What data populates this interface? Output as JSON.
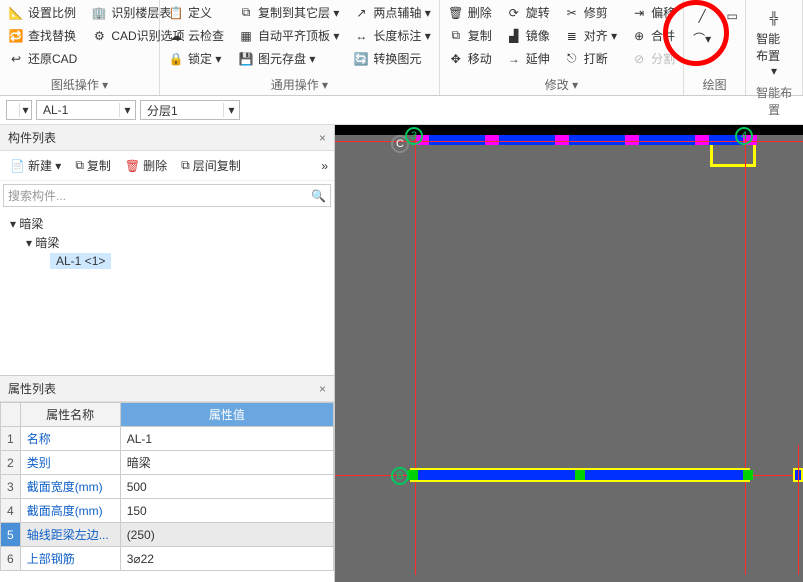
{
  "ribbon": {
    "left": {
      "items": [
        "设置比例",
        "查找替换",
        "还原CAD",
        "识别楼层表",
        "CAD识别选项"
      ],
      "label": "图纸操作 ▾"
    },
    "group2": {
      "col1": [
        "定义",
        "云检查",
        "锁定 ▾"
      ],
      "col2": [
        "复制到其它层 ▾",
        "自动平齐顶板 ▾",
        "图元存盘 ▾"
      ],
      "col3": [
        "两点辅轴 ▾",
        "长度标注 ▾",
        "转换图元"
      ],
      "label": "通用操作 ▾"
    },
    "group3": {
      "col1": [
        "删除",
        "复制",
        "移动"
      ],
      "col2": [
        "旋转",
        "镜像",
        "延伸"
      ],
      "col3": [
        "修剪",
        "对齐 ▾",
        "打断"
      ],
      "col4": [
        "偏移",
        "合并",
        "分割"
      ],
      "label": "修改 ▾"
    },
    "group4": {
      "label": "绘图"
    },
    "group5": {
      "big": "智能布置",
      "label": "智能布置"
    }
  },
  "selectors": {
    "left": "▾",
    "al": "AL-1",
    "layer": "分层1"
  },
  "componentList": {
    "title": "构件列表",
    "buttons": {
      "new": "新建 ▾",
      "copy": "复制",
      "del": "删除",
      "layercopy": "层间复制"
    },
    "searchPlaceholder": "搜索构件...",
    "tree": {
      "root": "暗梁",
      "child": "暗梁",
      "leaf": "AL-1 <1>"
    }
  },
  "propList": {
    "title": "属性列表",
    "headers": {
      "name": "属性名称",
      "value": "属性值"
    },
    "rows": [
      {
        "n": "1",
        "k": "名称",
        "v": "AL-1"
      },
      {
        "n": "2",
        "k": "类别",
        "v": "暗梁"
      },
      {
        "n": "3",
        "k": "截面宽度(mm)",
        "v": "500"
      },
      {
        "n": "4",
        "k": "截面高度(mm)",
        "v": "150"
      },
      {
        "n": "5",
        "k": "轴线距梁左边...",
        "v": "(250)"
      },
      {
        "n": "6",
        "k": "上部钢筋",
        "v": "3⌀22"
      }
    ]
  },
  "canvas": {
    "labels": {
      "c": "C",
      "b": "B",
      "three": "3",
      "four": "4"
    }
  }
}
